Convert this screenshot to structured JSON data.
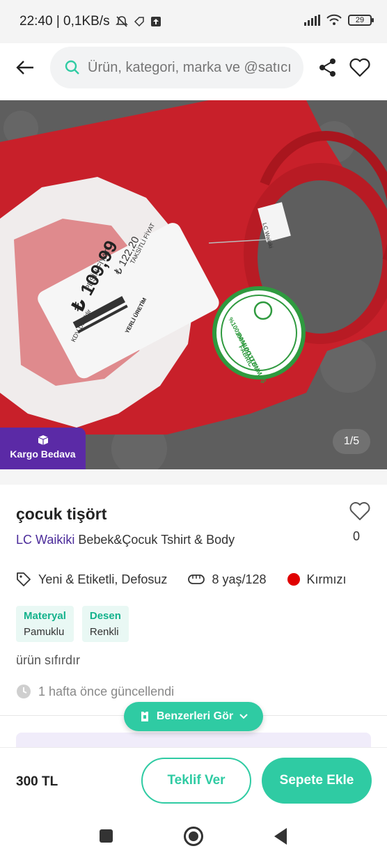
{
  "status_bar": {
    "time_speed": "22:40 | 0,1KB/s",
    "battery": "29"
  },
  "header": {
    "search_placeholder": "Ürün, kategori, marka ve @satıcı",
    "icons": [
      "back-arrow-icon",
      "search-icon",
      "share-icon",
      "heart-icon"
    ]
  },
  "gallery": {
    "badge_label": "Kargo Bedava",
    "page_indicator": "1/5",
    "tag": {
      "price_big": "₺ 109,99",
      "price_label": "PEŞİN FİYAT",
      "price_small": "₺ 122,20",
      "price_small_label": "TAKSİTLİ FİYAT",
      "kdv": "KDV Dahildir",
      "badge": "YERLİ ÜRETİM"
    },
    "sticker": {
      "line1": "%100 PAMUKLU KUMAŞ",
      "line2": "100% COTTON",
      "line3": "FABRIC"
    },
    "neck_label": "LC Waikiki"
  },
  "product": {
    "title": "çocuk tişört",
    "brand": "LC Waikiki",
    "category": "Bebek&Çocuk Tshirt & Body",
    "like_count": "0",
    "condition": "Yeni & Etiketli, Defosuz",
    "size": "8 yaş/128",
    "color": "Kırmızı",
    "color_hex": "#e00000",
    "chips": [
      {
        "title": "Materyal",
        "value": "Pamuklu"
      },
      {
        "title": "Desen",
        "value": "Renkli"
      }
    ],
    "description": "ürün sıfırdır",
    "updated": "1 hafta önce güncellendi"
  },
  "similar_button": "Benzerleri Gör",
  "bottom_bar": {
    "price": "300 TL",
    "offer_label": "Teklif Ver",
    "cart_label": "Sepete Ekle"
  },
  "colors": {
    "accent": "#2fcba3",
    "brand_purple": "#5b2aa6"
  }
}
